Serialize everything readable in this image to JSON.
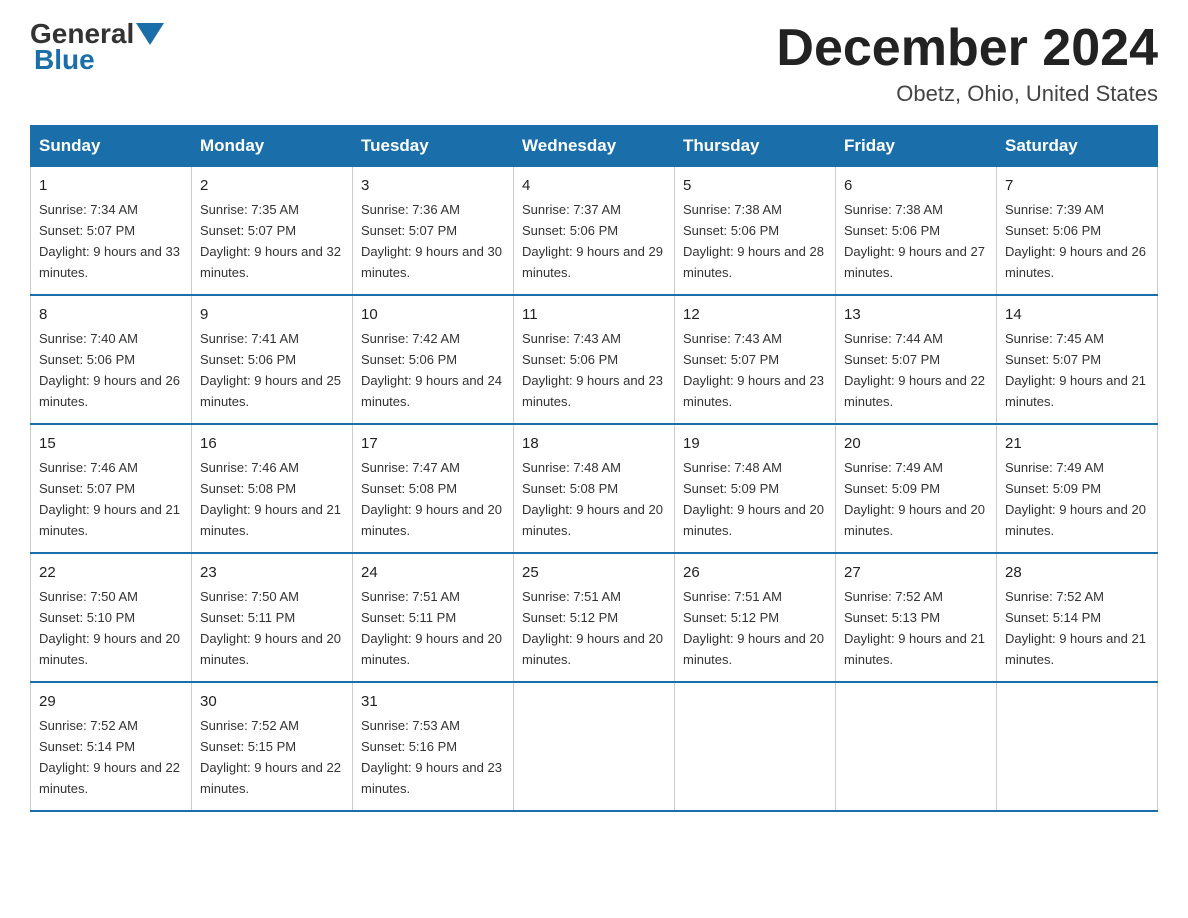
{
  "logo": {
    "general": "General",
    "blue": "Blue"
  },
  "title": "December 2024",
  "location": "Obetz, Ohio, United States",
  "days_header": [
    "Sunday",
    "Monday",
    "Tuesday",
    "Wednesday",
    "Thursday",
    "Friday",
    "Saturday"
  ],
  "weeks": [
    [
      {
        "day": "1",
        "sunrise": "7:34 AM",
        "sunset": "5:07 PM",
        "daylight": "9 hours and 33 minutes."
      },
      {
        "day": "2",
        "sunrise": "7:35 AM",
        "sunset": "5:07 PM",
        "daylight": "9 hours and 32 minutes."
      },
      {
        "day": "3",
        "sunrise": "7:36 AM",
        "sunset": "5:07 PM",
        "daylight": "9 hours and 30 minutes."
      },
      {
        "day": "4",
        "sunrise": "7:37 AM",
        "sunset": "5:06 PM",
        "daylight": "9 hours and 29 minutes."
      },
      {
        "day": "5",
        "sunrise": "7:38 AM",
        "sunset": "5:06 PM",
        "daylight": "9 hours and 28 minutes."
      },
      {
        "day": "6",
        "sunrise": "7:38 AM",
        "sunset": "5:06 PM",
        "daylight": "9 hours and 27 minutes."
      },
      {
        "day": "7",
        "sunrise": "7:39 AM",
        "sunset": "5:06 PM",
        "daylight": "9 hours and 26 minutes."
      }
    ],
    [
      {
        "day": "8",
        "sunrise": "7:40 AM",
        "sunset": "5:06 PM",
        "daylight": "9 hours and 26 minutes."
      },
      {
        "day": "9",
        "sunrise": "7:41 AM",
        "sunset": "5:06 PM",
        "daylight": "9 hours and 25 minutes."
      },
      {
        "day": "10",
        "sunrise": "7:42 AM",
        "sunset": "5:06 PM",
        "daylight": "9 hours and 24 minutes."
      },
      {
        "day": "11",
        "sunrise": "7:43 AM",
        "sunset": "5:06 PM",
        "daylight": "9 hours and 23 minutes."
      },
      {
        "day": "12",
        "sunrise": "7:43 AM",
        "sunset": "5:07 PM",
        "daylight": "9 hours and 23 minutes."
      },
      {
        "day": "13",
        "sunrise": "7:44 AM",
        "sunset": "5:07 PM",
        "daylight": "9 hours and 22 minutes."
      },
      {
        "day": "14",
        "sunrise": "7:45 AM",
        "sunset": "5:07 PM",
        "daylight": "9 hours and 21 minutes."
      }
    ],
    [
      {
        "day": "15",
        "sunrise": "7:46 AM",
        "sunset": "5:07 PM",
        "daylight": "9 hours and 21 minutes."
      },
      {
        "day": "16",
        "sunrise": "7:46 AM",
        "sunset": "5:08 PM",
        "daylight": "9 hours and 21 minutes."
      },
      {
        "day": "17",
        "sunrise": "7:47 AM",
        "sunset": "5:08 PM",
        "daylight": "9 hours and 20 minutes."
      },
      {
        "day": "18",
        "sunrise": "7:48 AM",
        "sunset": "5:08 PM",
        "daylight": "9 hours and 20 minutes."
      },
      {
        "day": "19",
        "sunrise": "7:48 AM",
        "sunset": "5:09 PM",
        "daylight": "9 hours and 20 minutes."
      },
      {
        "day": "20",
        "sunrise": "7:49 AM",
        "sunset": "5:09 PM",
        "daylight": "9 hours and 20 minutes."
      },
      {
        "day": "21",
        "sunrise": "7:49 AM",
        "sunset": "5:09 PM",
        "daylight": "9 hours and 20 minutes."
      }
    ],
    [
      {
        "day": "22",
        "sunrise": "7:50 AM",
        "sunset": "5:10 PM",
        "daylight": "9 hours and 20 minutes."
      },
      {
        "day": "23",
        "sunrise": "7:50 AM",
        "sunset": "5:11 PM",
        "daylight": "9 hours and 20 minutes."
      },
      {
        "day": "24",
        "sunrise": "7:51 AM",
        "sunset": "5:11 PM",
        "daylight": "9 hours and 20 minutes."
      },
      {
        "day": "25",
        "sunrise": "7:51 AM",
        "sunset": "5:12 PM",
        "daylight": "9 hours and 20 minutes."
      },
      {
        "day": "26",
        "sunrise": "7:51 AM",
        "sunset": "5:12 PM",
        "daylight": "9 hours and 20 minutes."
      },
      {
        "day": "27",
        "sunrise": "7:52 AM",
        "sunset": "5:13 PM",
        "daylight": "9 hours and 21 minutes."
      },
      {
        "day": "28",
        "sunrise": "7:52 AM",
        "sunset": "5:14 PM",
        "daylight": "9 hours and 21 minutes."
      }
    ],
    [
      {
        "day": "29",
        "sunrise": "7:52 AM",
        "sunset": "5:14 PM",
        "daylight": "9 hours and 22 minutes."
      },
      {
        "day": "30",
        "sunrise": "7:52 AM",
        "sunset": "5:15 PM",
        "daylight": "9 hours and 22 minutes."
      },
      {
        "day": "31",
        "sunrise": "7:53 AM",
        "sunset": "5:16 PM",
        "daylight": "9 hours and 23 minutes."
      },
      null,
      null,
      null,
      null
    ]
  ]
}
